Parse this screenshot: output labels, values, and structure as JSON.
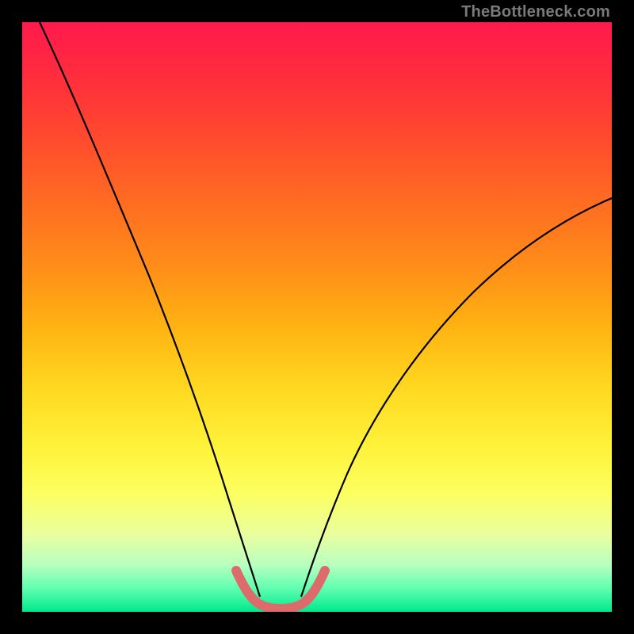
{
  "watermark": "TheBottleneck.com",
  "chart_data": {
    "type": "line",
    "title": "",
    "xlabel": "",
    "ylabel": "",
    "xlim": [
      0,
      100
    ],
    "ylim": [
      0,
      100
    ],
    "grid": false,
    "legend": false,
    "series": [
      {
        "name": "left-curve",
        "color": "#000000",
        "x": [
          3,
          6,
          10,
          14,
          18,
          22,
          26,
          30,
          33,
          35,
          37.5,
          39
        ],
        "values": [
          100,
          90,
          78,
          66,
          54,
          43,
          32,
          21,
          13,
          8,
          4,
          1.5
        ]
      },
      {
        "name": "right-curve",
        "color": "#000000",
        "x": [
          47,
          49,
          52,
          56,
          60,
          65,
          70,
          76,
          83,
          90,
          95,
          100
        ],
        "values": [
          1.5,
          4,
          9,
          17,
          25,
          33,
          41,
          49,
          56,
          62,
          66,
          70
        ]
      },
      {
        "name": "well-highlight",
        "color": "#e06666",
        "x": [
          36,
          37,
          38,
          39,
          41,
          43,
          45,
          47,
          48,
          49,
          50
        ],
        "values": [
          7,
          5,
          3.2,
          1.8,
          1.0,
          0.8,
          1.0,
          1.8,
          3.2,
          5,
          7
        ]
      }
    ]
  }
}
